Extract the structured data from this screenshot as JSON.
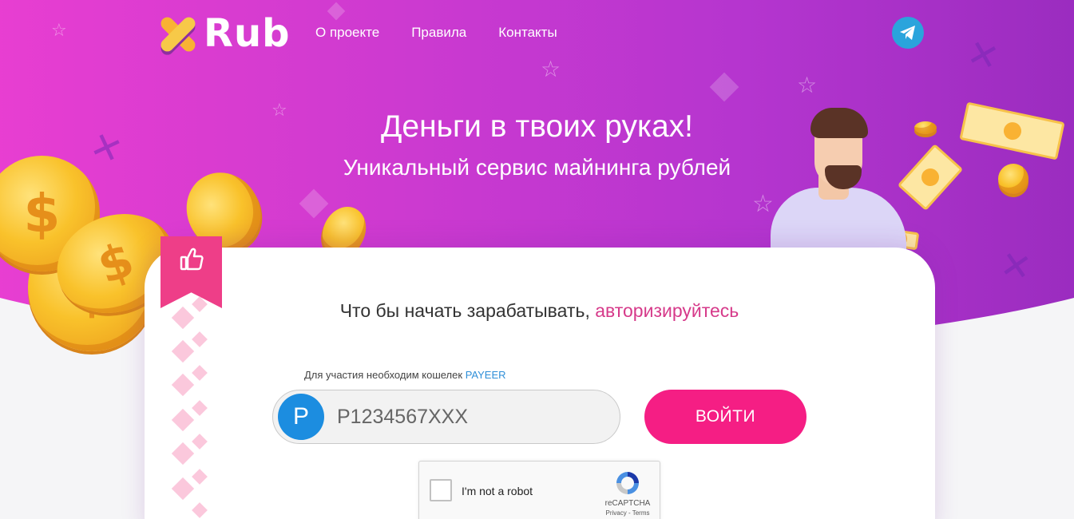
{
  "header": {
    "logo_text": "Rub",
    "nav": [
      {
        "label": "О проекте"
      },
      {
        "label": "Правила"
      },
      {
        "label": "Контакты"
      }
    ],
    "telegram_icon": "telegram-icon"
  },
  "hero": {
    "title": "Деньги в твоих руках!",
    "subtitle": "Уникальный сервис майнинга рублей"
  },
  "login": {
    "prompt": "Что бы начать зарабатывать,",
    "prompt_accent": "авторизируйтесь",
    "wallet_note": "Для участия необходим кошелек",
    "wallet_brand": "PAYEER",
    "wallet_badge": "P",
    "wallet_placeholder": "P1234567XXX",
    "wallet_value": "",
    "submit_label": "ВОЙТИ"
  },
  "captcha": {
    "label": "I'm not a robot",
    "brand": "reCAPTCHA",
    "links": "Privacy - Terms",
    "checked": false
  },
  "colors": {
    "hero_gradient_start": "#f23fd2",
    "hero_gradient_end": "#8e28b8",
    "accent_pink": "#f51e84",
    "payeer_blue": "#1c8de0",
    "telegram_blue": "#2aa4dc"
  }
}
